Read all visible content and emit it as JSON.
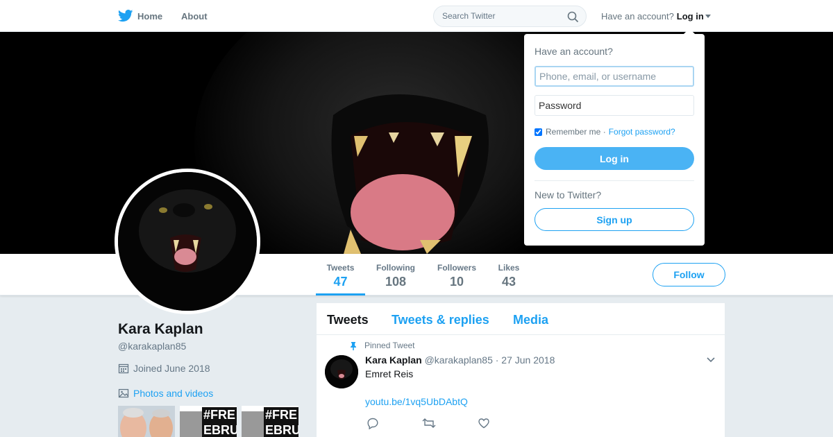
{
  "nav": {
    "home_label": "Home",
    "about_label": "About",
    "search_placeholder": "Search Twitter",
    "have_account": "Have an account?",
    "login_label": "Log in"
  },
  "profile_nav": {
    "stats": [
      {
        "label": "Tweets",
        "value": "47"
      },
      {
        "label": "Following",
        "value": "108"
      },
      {
        "label": "Followers",
        "value": "10"
      },
      {
        "label": "Likes",
        "value": "43"
      }
    ],
    "follow_label": "Follow"
  },
  "profile": {
    "name": "Kara Kaplan",
    "handle": "@karakaplan85",
    "joined": "Joined June 2018",
    "photos_label": "Photos and videos",
    "thumb_tag_text": "#FRE EBRU"
  },
  "timeline": {
    "tabs": [
      "Tweets",
      "Tweets & replies",
      "Media"
    ],
    "pinned_label": "Pinned Tweet",
    "tweet": {
      "name": "Kara Kaplan",
      "handle_date": "@karakaplan85 · 27 Jun 2018",
      "text": "Emret Reis",
      "link": "youtu.be/1vq5UbDAbtQ"
    }
  },
  "login_dropdown": {
    "title": "Have an account?",
    "username_placeholder": "Phone, email, or username",
    "password_placeholder": "Password",
    "remember_label": "Remember me ·",
    "forgot_label": "Forgot password?",
    "login_button": "Log in",
    "new_label": "New to Twitter?",
    "signup_button": "Sign up"
  },
  "colors": {
    "accent": "#1da1f2",
    "background": "#e6ecf0",
    "login_button": "#4ab3f4"
  }
}
